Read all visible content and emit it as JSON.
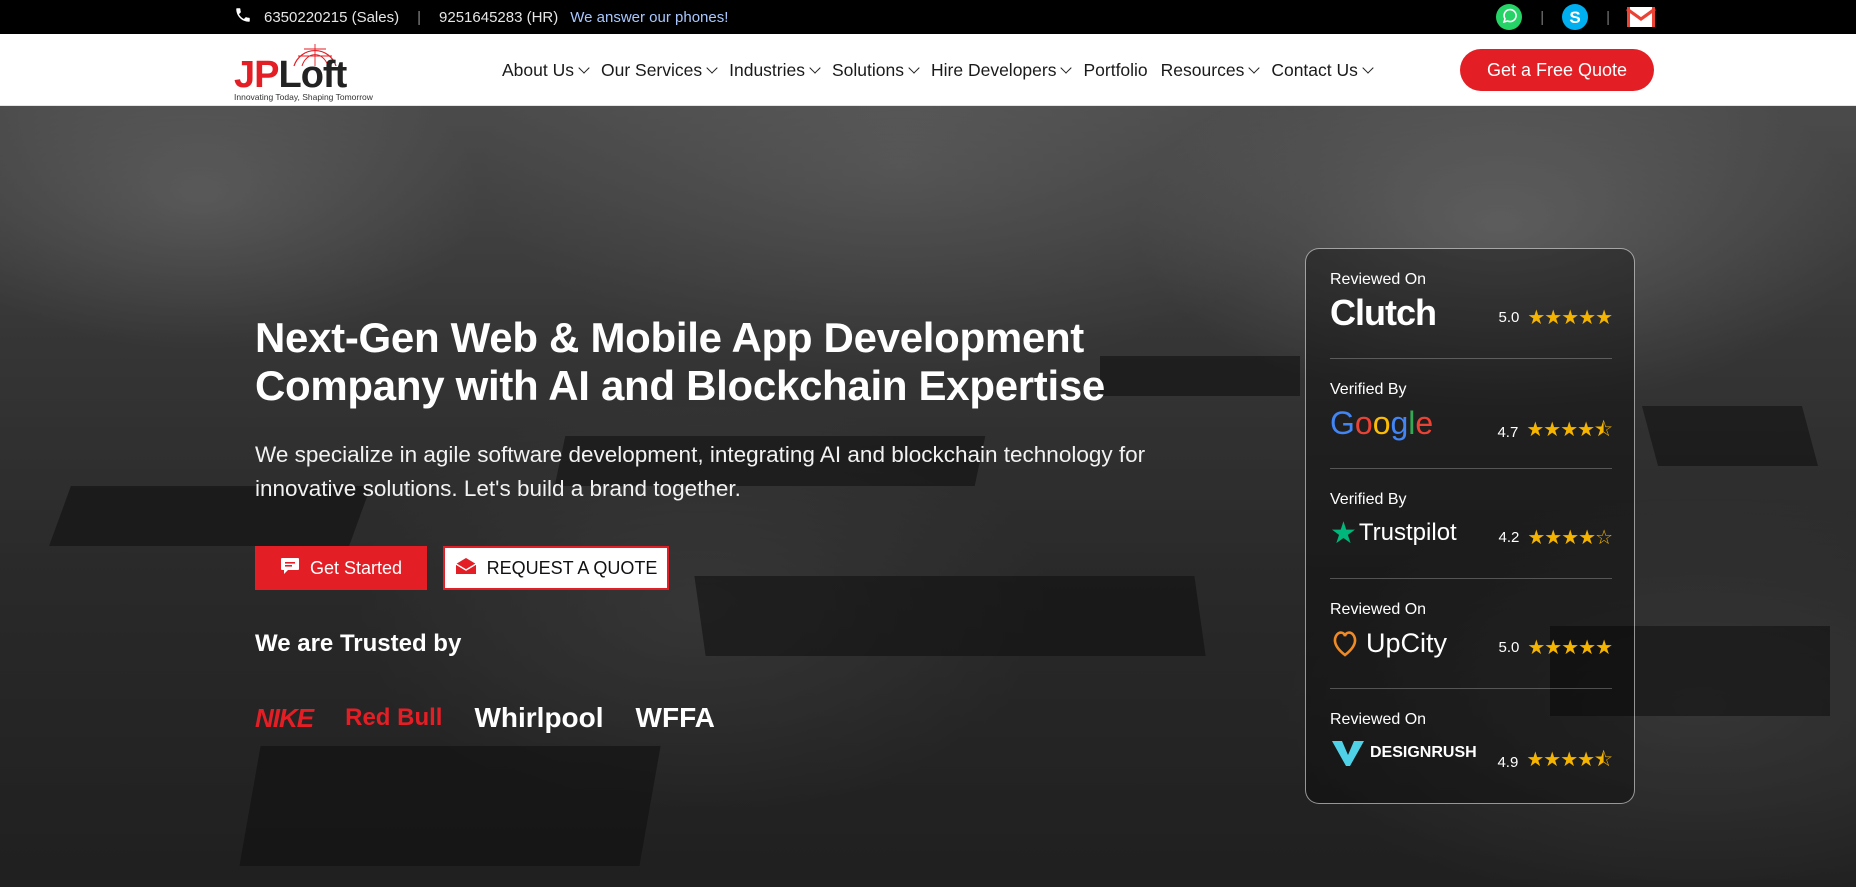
{
  "topbar": {
    "sales_phone": "6350220215 (Sales)",
    "hr_phone": "9251645283 (HR)",
    "tagline": "We answer our phones!",
    "separator": "|"
  },
  "logo": {
    "jp": "JP",
    "loft": "Loft",
    "tagline": "Innovating Today, Shaping Tomorrow"
  },
  "nav": {
    "items": [
      {
        "label": "About Us",
        "dropdown": true
      },
      {
        "label": "Our Services",
        "dropdown": true
      },
      {
        "label": "Industries",
        "dropdown": true
      },
      {
        "label": "Solutions",
        "dropdown": true
      },
      {
        "label": "Hire Developers",
        "dropdown": true
      },
      {
        "label": "Portfolio",
        "dropdown": false
      },
      {
        "label": "Resources",
        "dropdown": true
      },
      {
        "label": "Contact Us",
        "dropdown": true
      }
    ],
    "cta": "Get a Free Quote"
  },
  "hero": {
    "headline_line1": "Next-Gen Web & Mobile App Development",
    "headline_line2": "Company with AI and Blockchain Expertise",
    "subtext_line1": "We specialize in agile software development, integrating AI and blockchain technology for",
    "subtext_line2": "innovative solutions. Let's build a brand together.",
    "btn_start": "Get Started",
    "btn_quote": "REQUEST A QUOTE",
    "trusted": "We are Trusted by",
    "brands": [
      "NIKE",
      "Red Bull",
      "Whirlpool",
      "WFFA"
    ]
  },
  "reviews": [
    {
      "label": "Reviewed On",
      "platform": "Clutch",
      "score": "5.0",
      "stars": "★★★★★"
    },
    {
      "label": "Verified By",
      "platform": "Google",
      "score": "4.7",
      "stars": "★★★★⯪"
    },
    {
      "label": "Verified By",
      "platform": "Trustpilot",
      "score": "4.2",
      "stars": "★★★★☆"
    },
    {
      "label": "Reviewed On",
      "platform": "UpCity",
      "score": "5.0",
      "stars": "★★★★★"
    },
    {
      "label": "Reviewed On",
      "platform": "DESIGNRUSH",
      "score": "4.9",
      "stars": "★★★★⯪"
    }
  ],
  "colors": {
    "brand_red": "#e31e25",
    "star": "#f5b400",
    "whatsapp": "#25d366",
    "skype": "#00aff0"
  },
  "icons": [
    "phone-icon",
    "whatsapp-icon",
    "skype-icon",
    "gmail-icon",
    "chat-icon",
    "envelope-icon",
    "chevron-down-icon"
  ]
}
